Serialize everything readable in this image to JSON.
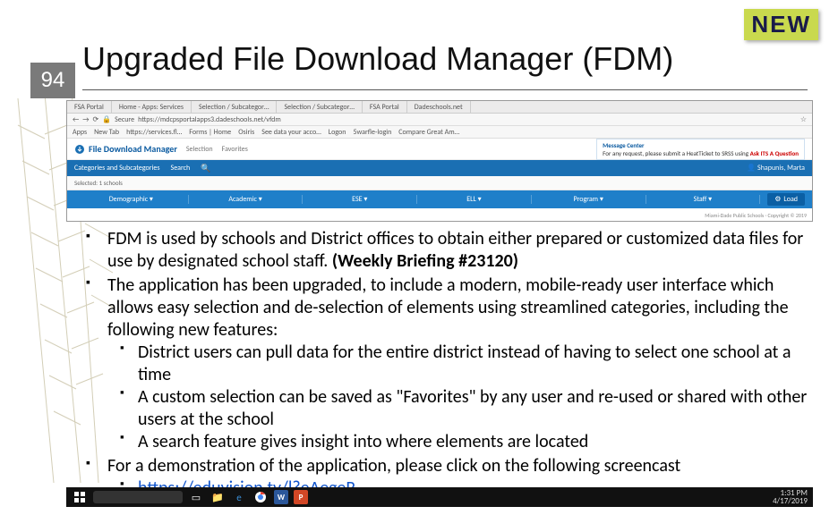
{
  "badge": {
    "text": "NEW"
  },
  "page_number": "94",
  "title": "Upgraded File Download Manager (FDM)",
  "screenshot": {
    "tabs": [
      "FSA Portal",
      "Home - Apps: Services",
      "Selection / Subcategor…",
      "Selection / Subcategor…",
      "FSA Portal",
      "Dadeschools.net"
    ],
    "secure_label": "Secure",
    "url": "https://mdcpsportalapps3.dadeschools.net/vfdm",
    "bookmarks": [
      "Apps",
      "New Tab",
      "https://services.fl…",
      "Forms | Home",
      "Osiris",
      "See data your acco…",
      "Logon",
      "5warfle-login",
      "Compare Great Am…"
    ],
    "app_brand": "File Download Manager",
    "app_nav": [
      "Selection",
      "Favorites"
    ],
    "msg_title": "Message Center",
    "msg_body_prefix": "For any request, please submit a HeatTicket to SRSS using ",
    "msg_body_link": "Ask ITS A Question",
    "bar1_label": "Categories and Subcategories",
    "bar1_search": "Search",
    "user_name": "Shapunis, Marta",
    "row2_label": "Selected: 1 schools",
    "categories": [
      "Demographic ▾",
      "Academic ▾",
      "ESE ▾",
      "ELL ▾",
      "Program ▾",
      "Staff ▾"
    ],
    "load_btn": "Load",
    "copyright": "Miami-Dade Public Schools · Copyright © 2019"
  },
  "bullets": {
    "b1_a": "FDM is used by schools and District offices to obtain either prepared or customized data files for use by designated school staff. ",
    "b1_b": "(Weekly Briefing #23120)",
    "b2": "The application has been upgraded, to include a modern, mobile-ready user interface which allows easy selection and de-selection of elements using streamlined categories, including the following new features:",
    "b2_sub": [
      "District users can pull data for the entire district instead of having to select one school at a time",
      "A custom selection can be saved as \"Favorites\" by any user and re-used or shared with other users at the school",
      "A search feature gives insight into where elements are located"
    ],
    "b3": "For a demonstration of the application, please click on the following screencast",
    "b3_link": "https://eduvision.tv/l?eAegeR"
  },
  "taskbar": {
    "time": "1:31 PM",
    "date": "4/17/2019"
  }
}
